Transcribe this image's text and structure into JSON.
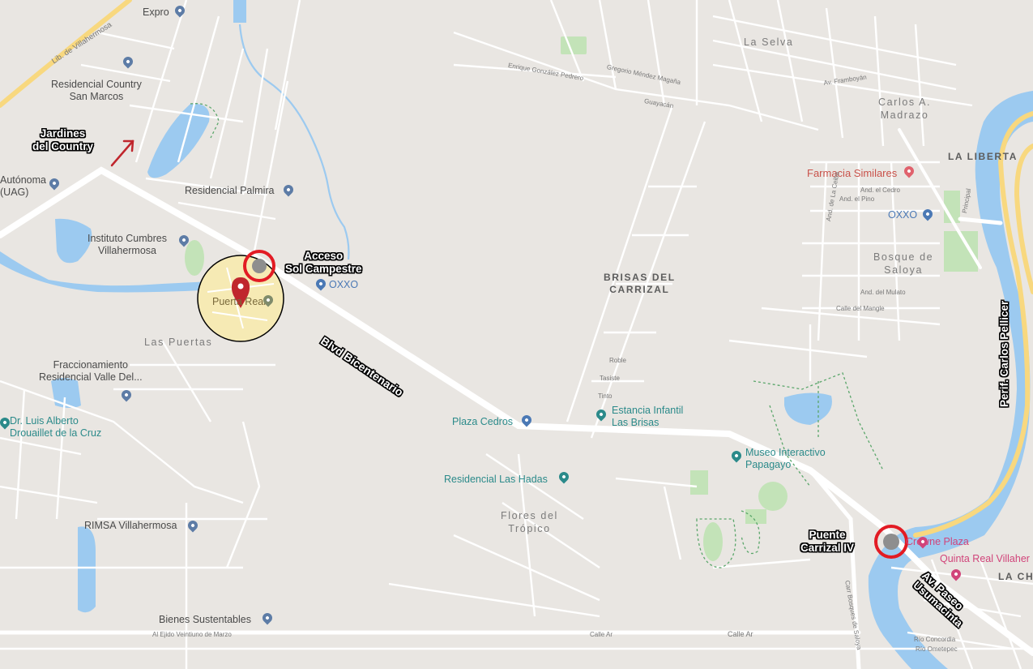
{
  "callouts": {
    "jardines": "Jardines\ndel Country",
    "acceso": "Acceso\nSol Campestre",
    "blvd": "Blvd Bicentenario",
    "puente": "Puente\nCarrizal IV",
    "periferico": "Perif. Carlos Pellicer",
    "paseo": "Av. Paseo\nUsumacinta"
  },
  "pois": {
    "expro": "Expro",
    "residencial_country": "Residencial Country\nSan Marcos",
    "autonoma": "Autónoma\n(UAG)",
    "residencial_palmira": "Residencial Palmira",
    "instituto": "Instituto Cumbres\nVillahermosa",
    "oxxo_left": "OXXO",
    "puerta_real": "Puerta Real",
    "fraccionamiento": "Fraccionamiento\nResidencial Valle Del...",
    "dr_luis": "Dr. Luis Alberto\nDrouaillet de la Cruz",
    "plaza_cedros": "Plaza Cedros",
    "estancia": "Estancia Infantil\nLas Brisas",
    "museo": "Museo Interactivo\nPapagayo",
    "residencial_hadas": "Residencial Las Hadas",
    "rimsa": "RIMSA Villahermosa",
    "bienes": "Bienes Sustentables",
    "farmacia": "Farmacia Similares",
    "oxxo_right": "OXXO",
    "quinta_real": "Quinta Real Villaher",
    "crowne": "Crowne Plaza"
  },
  "areas": {
    "las_puertas": "Las Puertas",
    "brisas": "BRISAS DEL\nCARRIZAL",
    "flores": "Flores del\nTrópico",
    "la_selva": "La Selva",
    "carlos": "Carlos A.\nMadrazo",
    "libertad": "LA LIBERTA",
    "bosque": "Bosque de\nSaloya",
    "la_ch": "LA CH"
  },
  "streets": {
    "lib": "Lib. de Villahermosa",
    "calle_ar_1": "Calle Ar",
    "calle_ar_2": "Calle Ar",
    "ejido": "Al Ejido Veintiuno de Marzo",
    "carr_bosques": "Carr Bosques de Saloya",
    "enrique": "Enrique González Pedrero",
    "gregorio": "Gregorio Méndez Magaña",
    "guayacan": "Guayacán",
    "principal": "Principal",
    "la_ceiba": "And. de La Ceiba",
    "el_cedro": "And. el Cedro",
    "el_pino": "And. el Pino",
    "mulato": "And. del Mulato",
    "mangle": "Calle del Mangle",
    "framboyan": "Av. Framboyán",
    "robles": "Roble",
    "tabachin": "Tasiste",
    "tinto": "Tinto",
    "rio_concordia": "Río Concordia",
    "rio_ometepec": "Río Ometepec"
  },
  "colors": {
    "land": "#e9e6e2",
    "road": "#ffffff",
    "highway": "#f8d87f",
    "water": "#9ccaf0",
    "park": "#c3e3b8",
    "marker": "#c0262d",
    "callout_ring": "#e21b24",
    "zone_fill": "#f6eab4"
  }
}
